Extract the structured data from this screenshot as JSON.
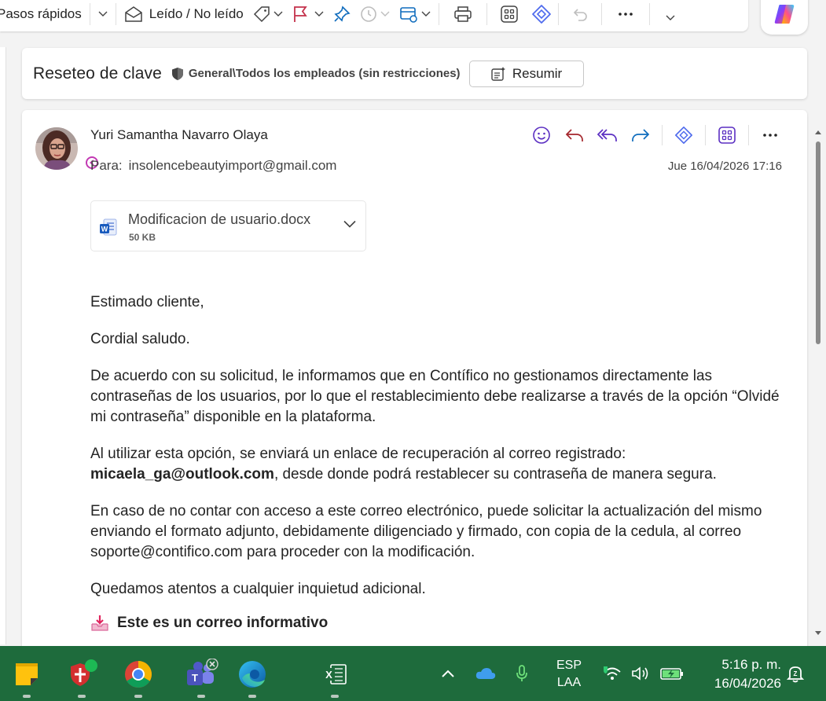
{
  "toolbar": {
    "quick_steps": "Pasos rápidos",
    "read_unread": "Leído / No leído"
  },
  "subject": {
    "title": "Reseteo de clave",
    "sensitivity": "General\\Todos los empleados (sin restricciones)",
    "summarize": "Resumir"
  },
  "message": {
    "sender": "Yuri Samantha Navarro Olaya",
    "to_label": "Para:",
    "to_address": "insolencebeautyimport@gmail.com",
    "date": "Jue 16/04/2026 17:16",
    "attachment": {
      "name": "Modificacion de usuario.docx",
      "size": "50 KB"
    },
    "body": {
      "greeting": "Estimado cliente,",
      "salutation": "Cordial saludo.",
      "p1": "De acuerdo con su solicitud, le informamos que en Contífico no gestionamos directamente las contraseñas de los usuarios, por lo que el restablecimiento debe realizarse a través de la opción “Olvidé mi contraseña” disponible en la plataforma.",
      "p2_start": "Al utilizar esta opción, se enviará un enlace de recuperación al correo registrado: ",
      "p2_email": "micaela_ga@outlook.com",
      "p2_end": ", desde donde podrá restablecer su contraseña de manera segura.",
      "p3": "En caso de no contar con acceso a este correo electrónico, puede solicitar la actualización del mismo enviando el formato adjunto, debidamente diligenciado y firmado, con copia de la cedula, al correo soporte@contifico.com para proceder con la modificación.",
      "p4": "Quedamos atentos a cualquier inquietud adicional.",
      "info": "Este es un correo informativo"
    }
  },
  "taskbar": {
    "lang_top": "ESP",
    "lang_bottom": "LAA",
    "time": "5:16 p. m.",
    "date": "16/04/2026"
  },
  "colors": {
    "accent_purple": "#5b2fc2",
    "flag_red": "#c4314b",
    "pin_blue": "#0f6cbd",
    "taskbar_bg": "#1e6b3c"
  },
  "icons": [
    "chevron-down-icon",
    "envelope-open-icon",
    "tag-icon",
    "flag-icon",
    "pin-icon",
    "clock-icon",
    "inbox-rules-icon",
    "print-icon",
    "apps-icon",
    "loop-icon",
    "undo-icon",
    "more-icon",
    "copilot-icon",
    "shield-icon",
    "summarize-icon",
    "emoji-icon",
    "reply-icon",
    "reply-all-icon",
    "forward-icon",
    "word-icon",
    "download-icon"
  ]
}
